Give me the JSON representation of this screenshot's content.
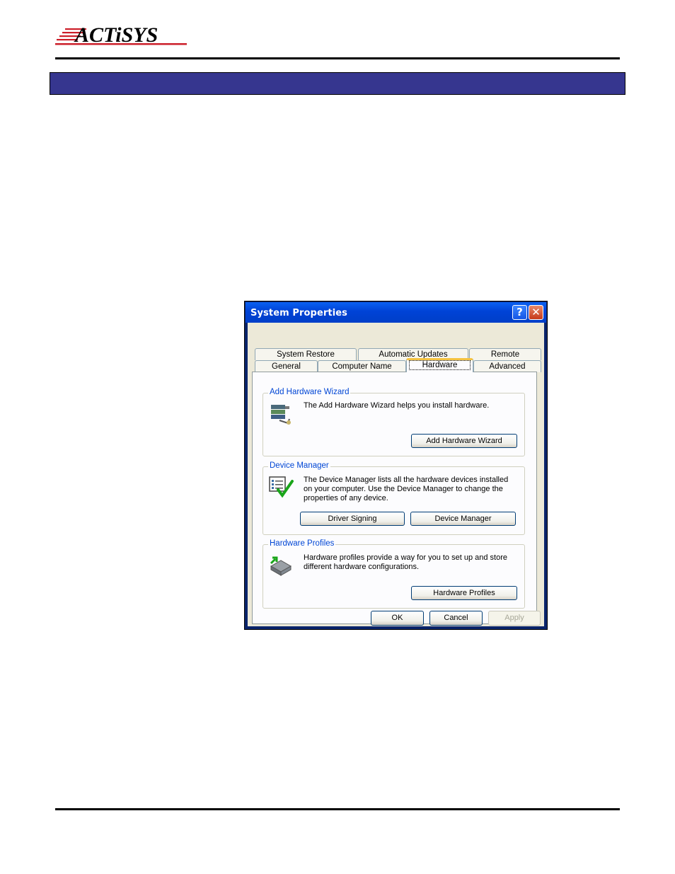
{
  "logo": {
    "text": "ACTiSYS",
    "color": "#cc1f2a"
  },
  "colors": {
    "banner": "#36368f",
    "titlebar": "#0050e0",
    "dialog_bg": "#ece9d8",
    "group_label": "#0046d5"
  },
  "dialog": {
    "title": "System Properties",
    "help_glyph": "?",
    "close_glyph": "✕",
    "tabs_row1": [
      "System Restore",
      "Automatic Updates",
      "Remote"
    ],
    "tabs_row2": [
      "General",
      "Computer Name",
      "Hardware",
      "Advanced"
    ],
    "active_tab": "Hardware",
    "groups": {
      "wizard": {
        "label": "Add Hardware Wizard",
        "description": "The Add Hardware Wizard helps you install hardware.",
        "icon": "add-hardware-icon",
        "button": "Add Hardware Wizard"
      },
      "device_manager": {
        "label": "Device Manager",
        "description": "The Device Manager lists all the hardware devices installed on your computer. Use the Device Manager to change the properties of any device.",
        "icon": "device-manager-icon",
        "button_signing": "Driver Signing",
        "button_manager": "Device Manager"
      },
      "profiles": {
        "label": "Hardware Profiles",
        "description": "Hardware profiles provide a way for you to set up and store different hardware configurations.",
        "icon": "hardware-profiles-icon",
        "button": "Hardware Profiles"
      }
    },
    "buttons": {
      "ok": "OK",
      "cancel": "Cancel",
      "apply": "Apply"
    }
  }
}
